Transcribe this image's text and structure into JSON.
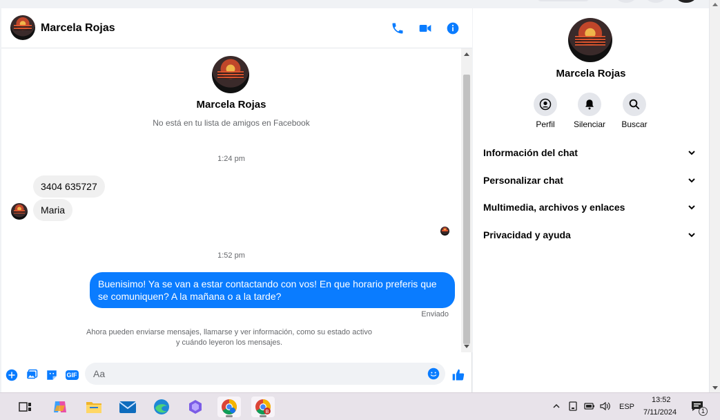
{
  "colors": {
    "accent": "#0a7cff",
    "bubble_in": "#f0f0f0",
    "muted": "#65676b"
  },
  "chat": {
    "header": {
      "name": "Marcela Rojas",
      "icons": [
        "phone-icon",
        "video-camera-icon",
        "info-icon"
      ]
    },
    "intro": {
      "name": "Marcela Rojas",
      "subtitle": "No está en tu lista de amigos en Facebook"
    },
    "messages": {
      "time_1": "1:24 pm",
      "incoming": [
        "3404 635727",
        "Maria"
      ],
      "time_2": "1:52 pm",
      "outgoing": "Buenisimo! Ya se van a estar contactando con vos! En que horario preferis que se comuniquen? A la mañana o a la tarde?",
      "status": "Enviado",
      "notice_line1": "Ahora pueden enviarse mensajes, llamarse y ver información, como su estado activo",
      "notice_line2": "y cuándo leyeron los mensajes."
    },
    "composer": {
      "placeholder": "Aa",
      "gif_label": "GIF",
      "icons": [
        "plus-icon",
        "image-icon",
        "sticker-icon",
        "gif-icon",
        "emoji-icon",
        "like-icon"
      ]
    }
  },
  "details": {
    "name": "Marcela Rojas",
    "actions": [
      {
        "label": "Perfil",
        "icon": "profile-icon"
      },
      {
        "label": "Silenciar",
        "icon": "bell-icon"
      },
      {
        "label": "Buscar",
        "icon": "search-icon"
      }
    ],
    "sections": [
      "Información del chat",
      "Personalizar chat",
      "Multimedia, archivos y enlaces",
      "Privacidad y ayuda"
    ]
  },
  "taskbar": {
    "apps": [
      "task-view-icon",
      "copilot-icon",
      "file-explorer-icon",
      "mail-icon",
      "edge-icon",
      "teams-icon",
      "chrome-icon",
      "chrome-profile-icon"
    ],
    "tray": {
      "language": "ESP",
      "time": "13:52",
      "date": "7/11/2024",
      "notification_count": "1"
    }
  }
}
